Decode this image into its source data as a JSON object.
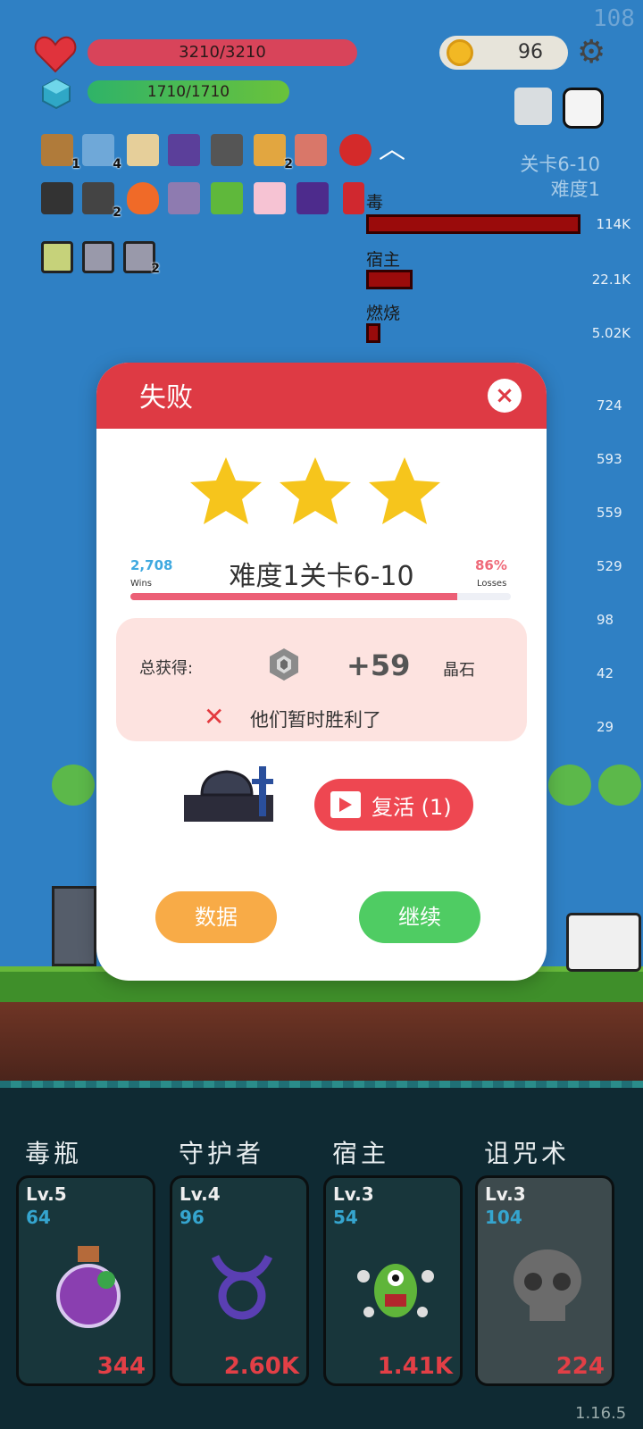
{
  "hud": {
    "fps": "108",
    "hp": "3210/3210",
    "mp": "1710/1710",
    "coins": "96",
    "stage_line1": "关卡6-10",
    "stage_line2": "难度1",
    "item_badges": [
      "1",
      "4",
      "2",
      "2",
      "2"
    ]
  },
  "damage_stats": [
    {
      "name": "毒",
      "value": "114K",
      "fraction": 1.0
    },
    {
      "name": "宿主",
      "value": "22.1K",
      "fraction": 0.2
    },
    {
      "name": "燃烧",
      "value": "5.02K",
      "fraction": 0.06
    }
  ],
  "side_values": [
    "724",
    "593",
    "559",
    "529",
    "98",
    "42",
    "29"
  ],
  "dialog": {
    "title": "失败",
    "close_label": "×",
    "stars": 3,
    "wins_value": "2,708",
    "wins_label": "Wins",
    "losses_value": "86%",
    "losses_label": "Losses",
    "win_fraction": 0.86,
    "level_title": "难度1关卡6-10",
    "reward_label": "总获得:",
    "reward_amount": "+59",
    "reward_unit": "晶石",
    "fail_mark": "✕",
    "fail_text": "他们暂时胜利了",
    "revive_label": "复活 (1)",
    "data_label": "数据",
    "continue_label": "继续"
  },
  "skills": [
    {
      "name": "毒瓶",
      "level": "Lv.5",
      "num": "64",
      "value": "344",
      "icon": "poison-potion-icon"
    },
    {
      "name": "守护者",
      "level": "Lv.4",
      "num": "96",
      "value": "2.60K",
      "icon": "taurus-symbol-icon"
    },
    {
      "name": "宿主",
      "level": "Lv.3",
      "num": "54",
      "value": "1.41K",
      "icon": "green-monster-icon"
    },
    {
      "name": "诅咒术",
      "level": "Lv.3",
      "num": "104",
      "value": "224",
      "icon": "skull-icon"
    }
  ],
  "version": "1.16.5",
  "colors": {
    "header_red": "#de3a44",
    "accent_blue": "#35a5cf",
    "damage_red": "#e23f46"
  }
}
